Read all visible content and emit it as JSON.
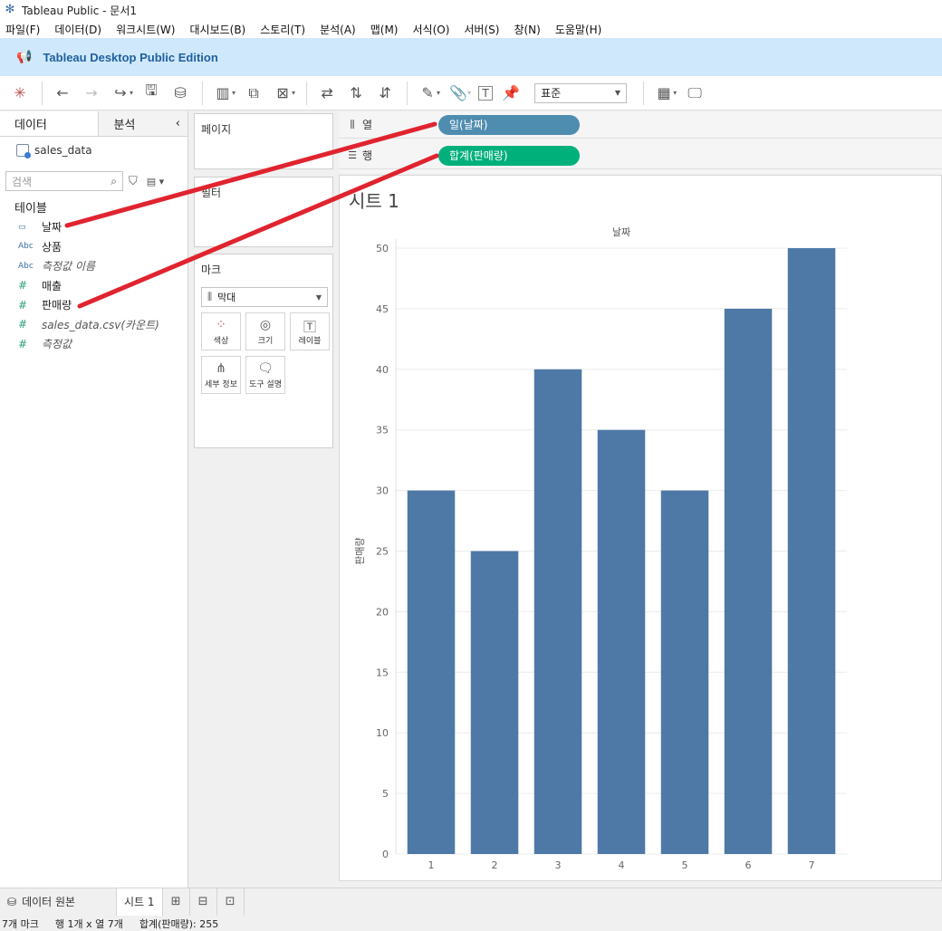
{
  "window": {
    "title": "Tableau Public - 문서1"
  },
  "menu": [
    "파일(F)",
    "데이터(D)",
    "워크시트(W)",
    "대시보드(B)",
    "스토리(T)",
    "분석(A)",
    "맵(M)",
    "서식(O)",
    "서버(S)",
    "창(N)",
    "도움말(H)"
  ],
  "banner": {
    "text": "Tableau Desktop Public Edition"
  },
  "toolbar": {
    "fit_select": "표준"
  },
  "data_pane": {
    "tab_data": "데이터",
    "tab_analysis": "분석",
    "datasource": "sales_data",
    "search_placeholder": "검색",
    "tables_heading": "테이블",
    "fields": [
      {
        "type": "date",
        "type_label": "▭",
        "name": "날짜",
        "italic": false
      },
      {
        "type": "str",
        "type_label": "Abc",
        "name": "상품",
        "italic": false
      },
      {
        "type": "str",
        "type_label": "Abc",
        "name": "측정값 이름",
        "italic": true
      },
      {
        "type": "num",
        "type_label": "#",
        "name": "매출",
        "italic": false
      },
      {
        "type": "num",
        "type_label": "#",
        "name": "판매량",
        "italic": false
      },
      {
        "type": "num",
        "type_label": "#",
        "name": "sales_data.csv(카운트)",
        "italic": true
      },
      {
        "type": "num",
        "type_label": "#",
        "name": "측정값",
        "italic": true
      }
    ]
  },
  "cards": {
    "pages": "페이지",
    "filters": "필터",
    "marks": "마크",
    "mark_type": "막대",
    "mark_buttons": [
      "색상",
      "크기",
      "레이블",
      "세부 정보",
      "도구 설명"
    ]
  },
  "shelves": {
    "columns_label": "열",
    "rows_label": "행",
    "columns_pill": "일(날짜)",
    "rows_pill": "합계(판매량)",
    "columns_color": "#4f8db0",
    "rows_color": "#00b07b"
  },
  "view": {
    "sheet_title": "시트 1"
  },
  "chart_data": {
    "type": "bar",
    "title": "날짜",
    "xlabel": "",
    "ylabel": "판매량",
    "categories": [
      "1",
      "2",
      "3",
      "4",
      "5",
      "6",
      "7"
    ],
    "values": [
      30,
      25,
      40,
      35,
      30,
      45,
      50
    ],
    "ylim": [
      0,
      50
    ],
    "yticks": [
      0,
      5,
      10,
      15,
      20,
      25,
      30,
      35,
      40,
      45,
      50
    ],
    "bar_color": "#4e79a7",
    "grid": true
  },
  "sheet_tabs": {
    "source_tab": "데이터 원본",
    "sheet_tab": "시트 1"
  },
  "status": {
    "marks": "7개 마크",
    "rows_cols": "행 1개 x 열 7개",
    "sum": "합계(판매량): 255"
  },
  "annotation_color": "#e0242f"
}
